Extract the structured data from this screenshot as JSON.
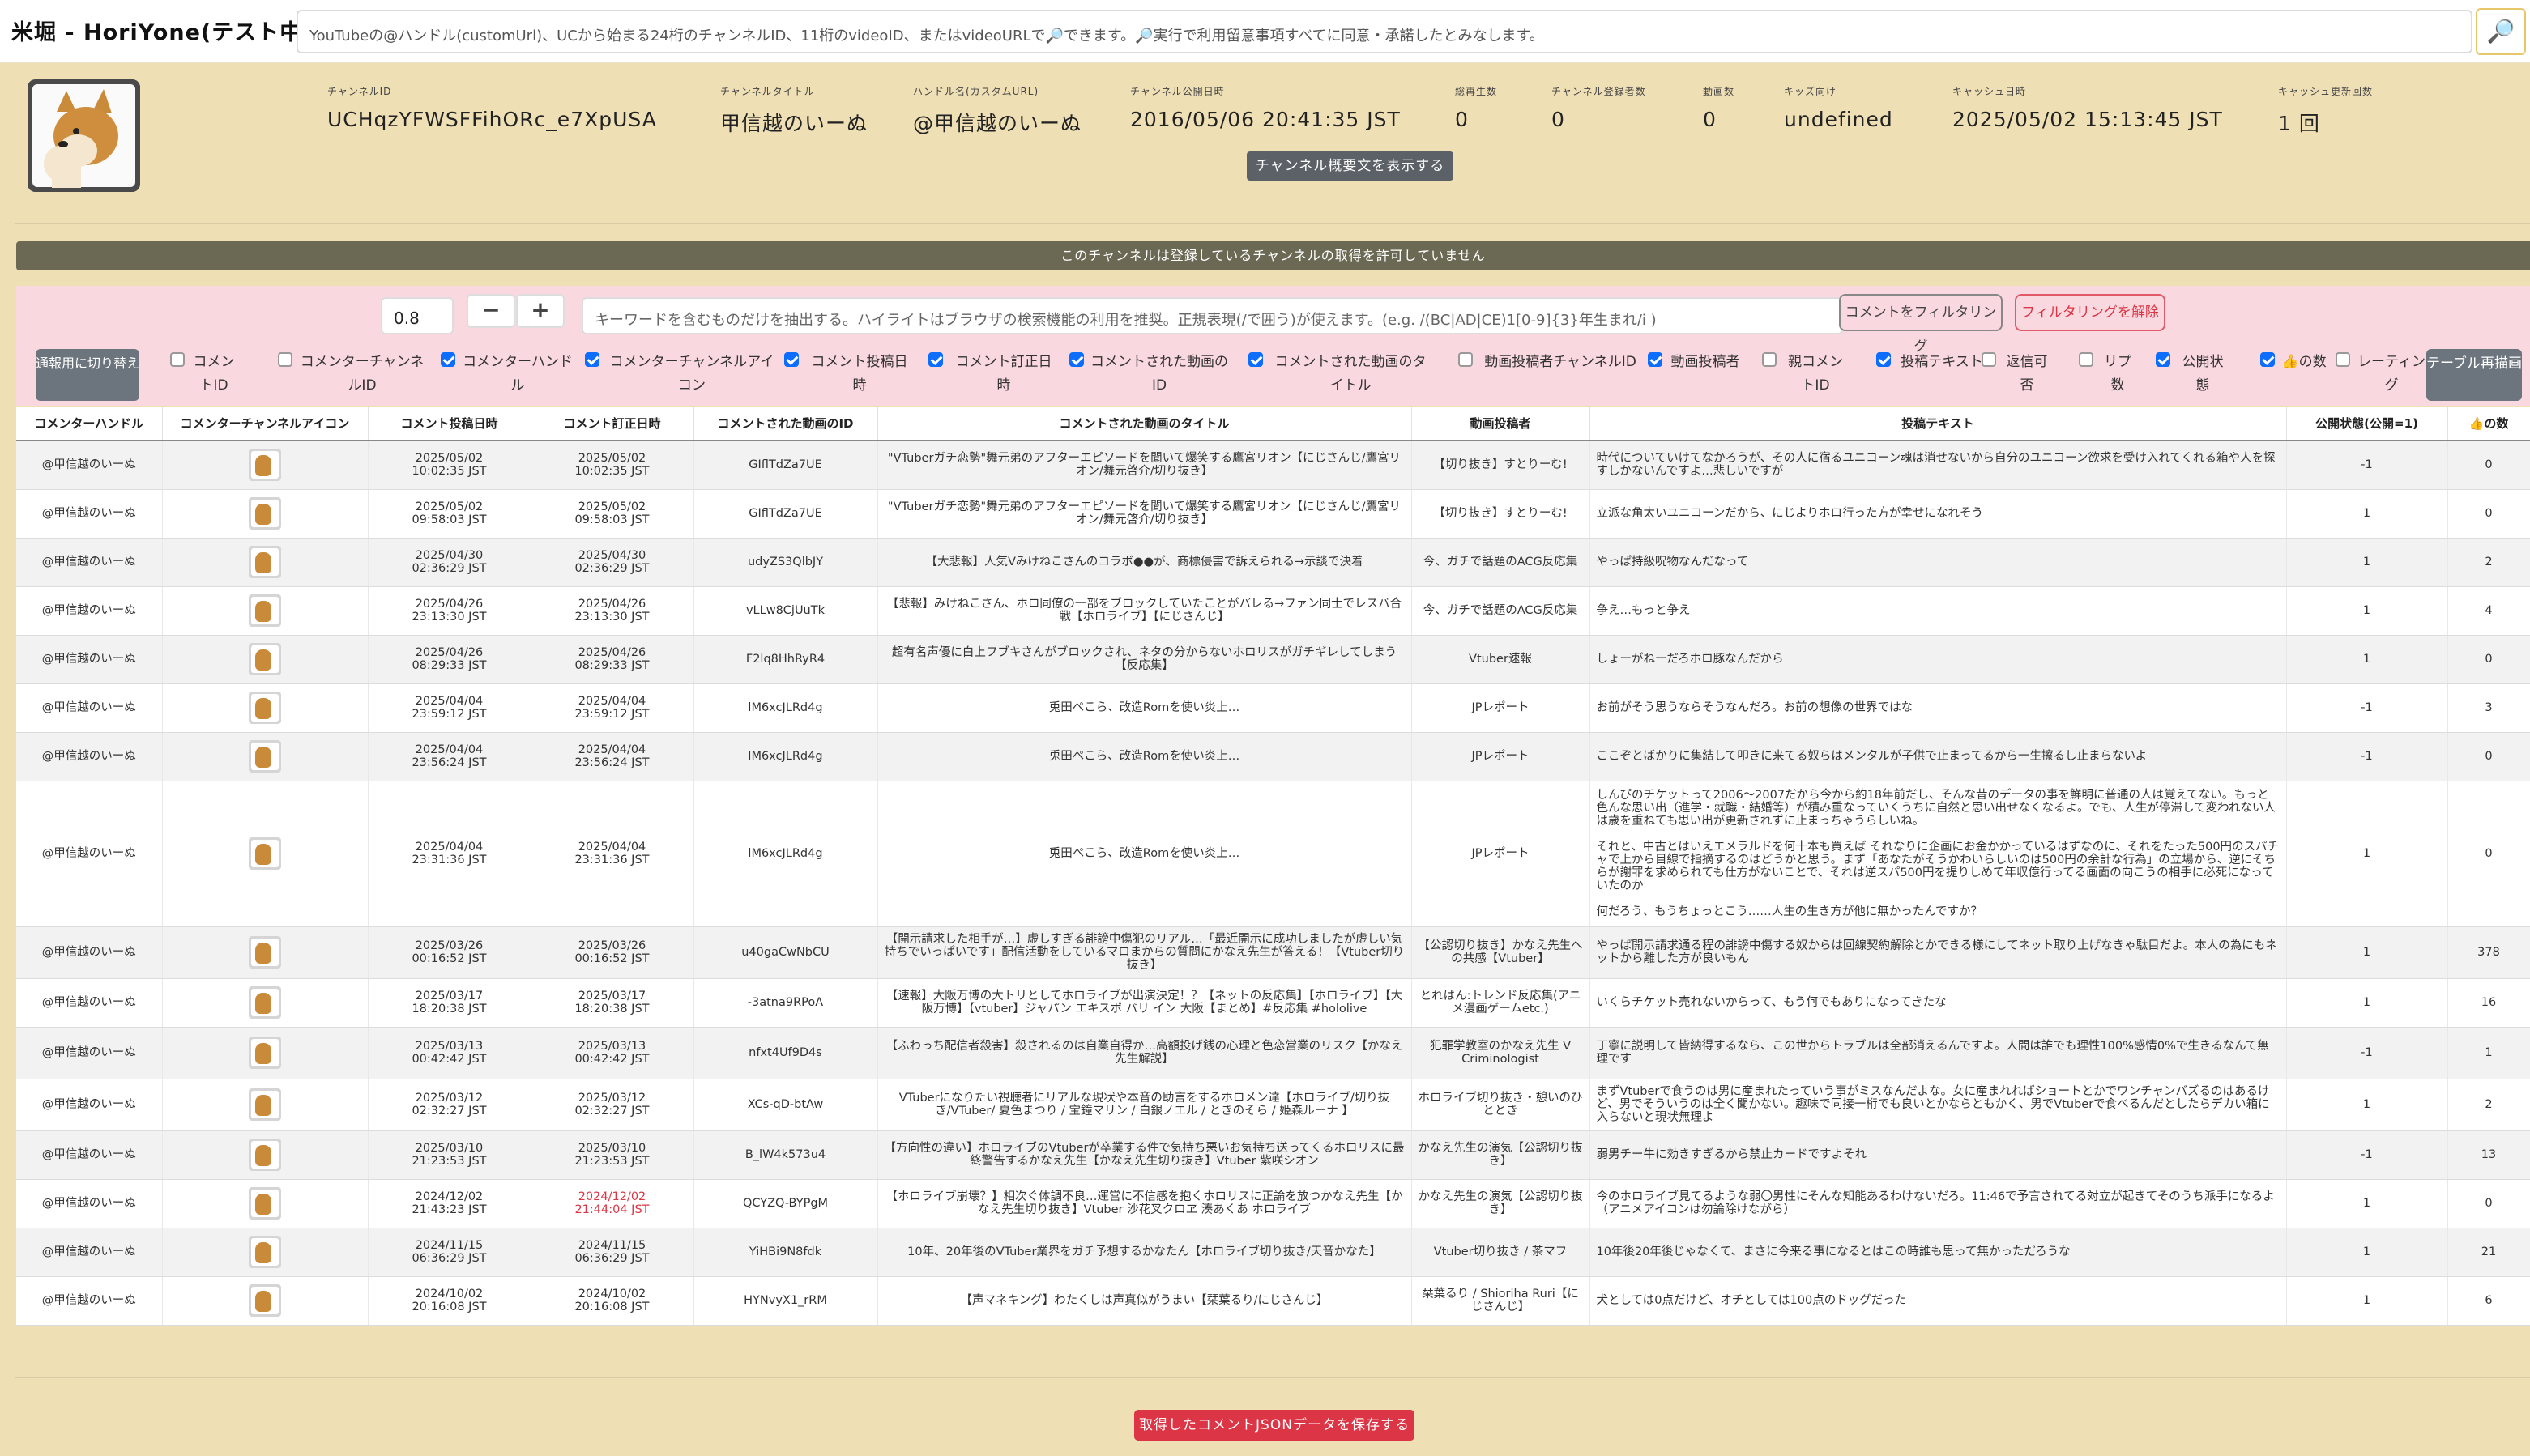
{
  "app": {
    "title": "米堀 - HoriYone(テスト中)"
  },
  "search": {
    "placeholder": "YouTubeの@ハンドル(customUrl)、UCから始まる24桁のチャンネルID、11桁のvideoID、またはvideoURLで🔎できます。🔎実行で利用留意事項すべてに同意・承諾したとみなします。",
    "button_icon": "🔎"
  },
  "channel": {
    "avatar_icon": "shiba-dog-avatar",
    "fields": [
      {
        "label": "チャンネルID",
        "value": "UCHqzYFWSFFihORc_e7XpUSA"
      },
      {
        "label": "チャンネルタイトル",
        "value": "甲信越のいーぬ"
      },
      {
        "label": "ハンドル名(カスタムURL)",
        "value": "@甲信越のいーぬ"
      },
      {
        "label": "チャンネル公開日時",
        "value": "2016/05/06 20:41:35 JST"
      },
      {
        "label": "総再生数",
        "value": "0"
      },
      {
        "label": "チャンネル登録者数",
        "value": "0"
      },
      {
        "label": "動画数",
        "value": "0"
      },
      {
        "label": "キッズ向け",
        "value": "undefined"
      },
      {
        "label": "キャッシュ日時",
        "value": "2025/05/02 15:13:45 JST"
      },
      {
        "label": "キャッシュ更新回数",
        "value": "1 回"
      }
    ],
    "show_description_button": "チャンネル概要文を表示する"
  },
  "notice": "このチャンネルは登録しているチャンネルの取得を許可していません",
  "filter": {
    "threshold_value": "0.8",
    "minus_label": "−",
    "plus_label": "+",
    "keyword_placeholder": "キーワードを含むものだけを抽出する。ハイライトはブラウザの検索機能の利用を推奨。正規表現(/で囲う)が使えます。(e.g. /(BC|AD|CE)1[0-9]{3}年生まれ/i )",
    "filter_button": "コメントをフィルタリング",
    "unfilter_button": "フィルタリングを解除",
    "toggle_mode_button": "通報用に切り替え",
    "redraw_button": "テーブル再描画",
    "columns": [
      {
        "label": "コメントID",
        "checked": false
      },
      {
        "label": "コメンターチャンネルID",
        "checked": false
      },
      {
        "label": "コメンターハンドル",
        "checked": true
      },
      {
        "label": "コメンターチャンネルアイコン",
        "checked": true
      },
      {
        "label": "コメント投稿日時",
        "checked": true
      },
      {
        "label": "コメント訂正日時",
        "checked": true
      },
      {
        "label": "コメントされた動画のID",
        "checked": true
      },
      {
        "label": "コメントされた動画のタイトル",
        "checked": true
      },
      {
        "label": "動画投稿者チャンネルID",
        "checked": false
      },
      {
        "label": "動画投稿者",
        "checked": true
      },
      {
        "label": "親コメントID",
        "checked": false
      },
      {
        "label": "投稿テキスト",
        "checked": true
      },
      {
        "label": "返信可否",
        "checked": false
      },
      {
        "label": "リプ数",
        "checked": false
      },
      {
        "label": "公開状態",
        "checked": true
      },
      {
        "label": "👍の数",
        "checked": true
      },
      {
        "label": "レーティング",
        "checked": false
      }
    ]
  },
  "table": {
    "headers": [
      "コメンターハンドル",
      "コメンターチャンネルアイコン",
      "コメント投稿日時",
      "コメント訂正日時",
      "コメントされた動画のID",
      "コメントされた動画のタイトル",
      "動画投稿者",
      "投稿テキスト",
      "公開状態(公開=1)",
      "👍の数"
    ],
    "rows": [
      {
        "handle": "@甲信越のいーぬ",
        "posted": "2025/05/02\n10:02:35 JST",
        "edited": "2025/05/02\n10:02:35 JST",
        "video_id": "GIflTdZa7UE",
        "title": "\"VTuberガチ恋勢\"舞元弟のアフターエピソードを聞いて爆笑する鷹宮リオン【にじさんじ/鷹宮リオン/舞元啓介/切り抜き】",
        "uploader": "【切り抜き】すとりーむ!",
        "text": "時代についていけてなかろうが、その人に宿るユニコーン魂は消せないから自分のユニコーン欲求を受け入れてくれる箱や人を探すしかないんですよ…悲しいですが",
        "status": "-1",
        "likes": "0"
      },
      {
        "handle": "@甲信越のいーぬ",
        "posted": "2025/05/02\n09:58:03 JST",
        "edited": "2025/05/02\n09:58:03 JST",
        "video_id": "GIflTdZa7UE",
        "title": "\"VTuberガチ恋勢\"舞元弟のアフターエピソードを聞いて爆笑する鷹宮リオン【にじさんじ/鷹宮リオン/舞元啓介/切り抜き】",
        "uploader": "【切り抜き】すとりーむ!",
        "text": "立派な角太いユニコーンだから、にじよりホロ行った方が幸せになれそう",
        "status": "1",
        "likes": "0"
      },
      {
        "handle": "@甲信越のいーぬ",
        "posted": "2025/04/30\n02:36:29 JST",
        "edited": "2025/04/30\n02:36:29 JST",
        "video_id": "udyZS3QlbJY",
        "title": "【大悲報】人気Vみけねこさんのコラボ●●が、商標侵害で訴えられる→示談で決着",
        "uploader": "今、ガチで話題のACG反応集",
        "text": "やっぱ持級呪物なんだなって",
        "status": "1",
        "likes": "2"
      },
      {
        "handle": "@甲信越のいーぬ",
        "posted": "2025/04/26\n23:13:30 JST",
        "edited": "2025/04/26\n23:13:30 JST",
        "video_id": "vLLw8CjUuTk",
        "title": "【悲報】みけねこさん、ホロ同僚の一部をブロックしていたことがバレる→ファン同士でレスバ合戦【ホロライブ】【にじさんじ】",
        "uploader": "今、ガチで話題のACG反応集",
        "text": "争え…もっと争え",
        "status": "1",
        "likes": "4"
      },
      {
        "handle": "@甲信越のいーぬ",
        "posted": "2025/04/26\n08:29:33 JST",
        "edited": "2025/04/26\n08:29:33 JST",
        "video_id": "F2lq8HhRyR4",
        "title": "超有名声優に白上フブキさんがブロックされ、ネタの分からないホロリスがガチギレしてしまう【反応集】",
        "uploader": "Vtuber速報",
        "text": "しょーがねーだろホロ豚なんだから",
        "status": "1",
        "likes": "0"
      },
      {
        "handle": "@甲信越のいーぬ",
        "posted": "2025/04/04\n23:59:12 JST",
        "edited": "2025/04/04\n23:59:12 JST",
        "video_id": "lM6xcJLRd4g",
        "title": "兎田ぺこら、改造Romを使い炎上…",
        "uploader": "JPレポート",
        "text": "お前がそう思うならそうなんだろ。お前の想像の世界ではな",
        "status": "-1",
        "likes": "3"
      },
      {
        "handle": "@甲信越のいーぬ",
        "posted": "2025/04/04\n23:56:24 JST",
        "edited": "2025/04/04\n23:56:24 JST",
        "video_id": "lM6xcJLRd4g",
        "title": "兎田ぺこら、改造Romを使い炎上…",
        "uploader": "JPレポート",
        "text": "ここぞとばかりに集結して叩きに来てる奴らはメンタルが子供で止まってるから一生擦るし止まらないよ",
        "status": "-1",
        "likes": "0"
      },
      {
        "handle": "@甲信越のいーぬ",
        "posted": "2025/04/04\n23:31:36 JST",
        "edited": "2025/04/04\n23:31:36 JST",
        "video_id": "lM6xcJLRd4g",
        "title": "兎田ぺこら、改造Romを使い炎上…",
        "uploader": "JPレポート",
        "text": "しんぴのチケットって2006～2007だから今から約18年前だし、そんな昔のデータの事を鮮明に普通の人は覚えてない。もっと色んな思い出（進学・就職・結婚等）が積み重なっていくうちに自然と思い出せなくなるよ。でも、人生が停滞して変われない人は歳を重ねても思い出が更新されずに止まっちゃうらしいね。\n\nそれと、中古とはいえエメラルドを何十本も買えば それなりに企画にお金かかっているはずなのに、それをたった500円のスパチャで上から目線で指摘するのはどうかと思う。まず「あなたがそうかわいらしいのは500円の余計な行為」の立場から、逆にそちらが謝罪を求められても仕方がないことで、それは逆スパ500円を提りしめて年収億行ってる画面の向こうの相手に必死になっていたのか\n\n何だろう、もうちょっとこう……人生の生き方が他に無かったんですか？",
        "status": "1",
        "likes": "0"
      },
      {
        "handle": "@甲信越のいーぬ",
        "posted": "2025/03/26\n00:16:52 JST",
        "edited": "2025/03/26\n00:16:52 JST",
        "video_id": "u40gaCwNbCU",
        "title": "【開示請求した相手が…】虚しすぎる誹謗中傷犯のリアル…「最近開示に成功しましたが虚しい気持ちでいっぱいです」配信活動をしているマロまからの質問にかなえ先生が答える！【Vtuber切り抜き】",
        "uploader": "【公認切り抜き】かなえ先生への共感【Vtuber】",
        "text": "やっぱ開示請求通る程の誹謗中傷する奴からは回線契約解除とかできる様にしてネット取り上げなきゃ駄目だよ。本人の為にもネットから離した方が良いもん",
        "status": "1",
        "likes": "378"
      },
      {
        "handle": "@甲信越のいーぬ",
        "posted": "2025/03/17\n18:20:38 JST",
        "edited": "2025/03/17\n18:20:38 JST",
        "video_id": "-3atna9RPoA",
        "title": "【速報】大阪万博の大トリとしてホロライブが出演決定！？【ネットの反応集】【ホロライブ】【大阪万博】【vtuber】ジャパン エキスポ パリ イン 大阪【まとめ】#反応集 #hololive",
        "uploader": "とれはん:トレンド反応集(アニメ漫画ゲームetc.)",
        "text": "いくらチケット売れないからって、もう何でもありになってきたな",
        "status": "1",
        "likes": "16"
      },
      {
        "handle": "@甲信越のいーぬ",
        "posted": "2025/03/13\n00:42:42 JST",
        "edited": "2025/03/13\n00:42:42 JST",
        "video_id": "nfxt4Uf9D4s",
        "title": "【ふわっち配信者殺害】殺されるのは自業自得か…高額投げ銭の心理と色恋営業のリスク【かなえ先生解説】",
        "uploader": "犯罪学教室のかなえ先生 V Criminologist",
        "text": "丁寧に説明して皆納得するなら、この世からトラブルは全部消えるんですよ。人間は誰でも理性100%感情0%で生きるなんて無理です",
        "status": "-1",
        "likes": "1"
      },
      {
        "handle": "@甲信越のいーぬ",
        "posted": "2025/03/12\n02:32:27 JST",
        "edited": "2025/03/12\n02:32:27 JST",
        "video_id": "XCs-qD-btAw",
        "title": "VTuberになりたい視聴者にリアルな現状や本音の助言をするホロメン達【ホロライブ/切り抜き/VTuber/ 夏色まつり / 宝鐘マリン / 白銀ノエル / ときのそら / 姫森ルーナ 】",
        "uploader": "ホロライブ切り抜き・憩いのひととき",
        "text": "まずVtuberで食うのは男に産まれたっていう事がミスなんだよな。女に産まれればショートとかでワンチャンバズるのはあるけど、男でそういうのは全く聞かない。趣味で同接一桁でも良いとかならともかく、男でVtuberで食べるんだとしたらデカい箱に入らないと現状無理よ",
        "status": "1",
        "likes": "2"
      },
      {
        "handle": "@甲信越のいーぬ",
        "posted": "2025/03/10\n21:23:53 JST",
        "edited": "2025/03/10\n21:23:53 JST",
        "video_id": "B_lW4k573u4",
        "title": "【方向性の違い】ホロライブのVtuberが卒業する件で気持ち悪いお気持ち送ってくるホロリスに最終警告するかなえ先生【かなえ先生切り抜き】Vtuber 紫咲シオン",
        "uploader": "かなえ先生の演気【公認切り抜き】",
        "text": "弱男チー牛に効きすぎるから禁止カードですよそれ",
        "status": "-1",
        "likes": "13"
      },
      {
        "handle": "@甲信越のいーぬ",
        "posted": "2024/12/02\n21:43:23 JST",
        "edited": "2024/12/02\n21:44:04 JST",
        "edited_late": true,
        "video_id": "QCYZQ-BYPgM",
        "title": "【ホロライブ崩壊？】相次ぐ体調不良…運営に不信感を抱くホロリスに正論を放つかなえ先生【かなえ先生切り抜き】Vtuber 沙花叉クロヱ 湊あくあ ホロライブ",
        "uploader": "かなえ先生の演気【公認切り抜き】",
        "text": "今のホロライブ見てるような弱〇男性にそんな知能あるわけないだろ。11:46で予言されてる対立が起きてそのうち派手になるよ（アニメアイコンは勿論除けながら）",
        "status": "1",
        "likes": "0"
      },
      {
        "handle": "@甲信越のいーぬ",
        "posted": "2024/11/15\n06:36:29 JST",
        "edited": "2024/11/15\n06:36:29 JST",
        "video_id": "YiHBi9N8fdk",
        "title": "10年、20年後のVTuber業界をガチ予想するかなたん【ホロライブ切り抜き/天音かなた】",
        "uploader": "Vtuber切り抜き / 茶マフ",
        "text": "10年後20年後じゃなくて、まさに今来る事になるとはこの時誰も思って無かっただろうな",
        "status": "1",
        "likes": "21"
      },
      {
        "handle": "@甲信越のいーぬ",
        "posted": "2024/10/02\n20:16:08 JST",
        "edited": "2024/10/02\n20:16:08 JST",
        "video_id": "HYNvyX1_rRM",
        "title": "【声マネキング】わたくしは声真似がうまい【栞葉るり/にじさんじ】",
        "uploader": "栞葉るり / Shioriha Ruri【にじさんじ】",
        "text": "犬としては0点だけど、オチとしては100点のドッグだった",
        "status": "1",
        "likes": "6"
      }
    ]
  },
  "save_button": "取得したコメントJSONデータを保存する",
  "colors": {
    "background": "#eedfb5",
    "filter_panel": "#f9d8df",
    "notice": "#6b6953",
    "danger": "#dc3545",
    "secondary_button": "#6c757d"
  }
}
